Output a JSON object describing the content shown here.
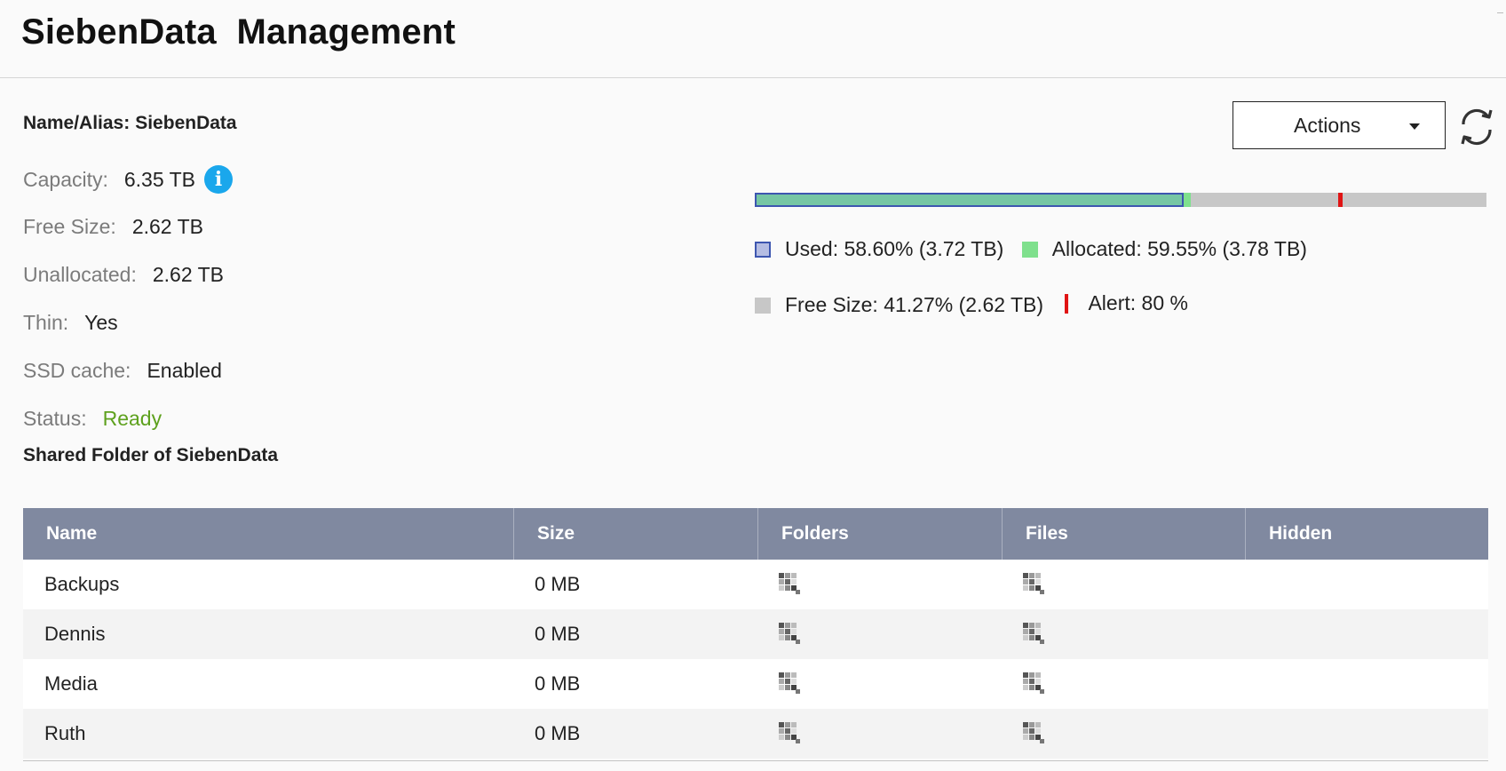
{
  "header": {
    "title": "SiebenData  Management"
  },
  "alias": {
    "label": "Name/Alias:",
    "value": "SiebenData"
  },
  "properties": {
    "capacity": {
      "label": "Capacity:",
      "value": "6.35 TB"
    },
    "free_size": {
      "label": "Free Size:",
      "value": "2.62 TB"
    },
    "unallocated": {
      "label": "Unallocated:",
      "value": "2.62 TB"
    },
    "thin": {
      "label": "Thin:",
      "value": "Yes"
    },
    "ssd_cache": {
      "label": "SSD cache:",
      "value": "Enabled"
    },
    "status": {
      "label": "Status:",
      "value": "Ready"
    }
  },
  "actions": {
    "label": "Actions"
  },
  "icons": {
    "info": "info-icon",
    "refresh": "refresh-icon",
    "dropdown": "caret-down-icon",
    "loading": "loading-placeholder-icon"
  },
  "usage": {
    "used_percent": 58.6,
    "allocated_percent": 59.55,
    "alert_percent": 80,
    "legend": {
      "used": "Used: 58.60% (3.72 TB)",
      "allocated": "Allocated: 59.55% (3.78 TB)",
      "free": "Free Size: 41.27% (2.62 TB)",
      "alert": "Alert: 80 %"
    }
  },
  "colors": {
    "ready": "#5ea11e",
    "used": "#3d56b0",
    "allocated": "#7fe08d",
    "free": "#c7c7c7",
    "alert": "#e01414",
    "table_header": "#8089a0",
    "info": "#1aa7ec"
  },
  "shared_folder": {
    "heading": "Shared Folder of SiebenData",
    "columns": [
      "Name",
      "Size",
      "Folders",
      "Files",
      "Hidden"
    ],
    "rows": [
      {
        "name": "Backups",
        "size": "0 MB"
      },
      {
        "name": "Dennis",
        "size": "0 MB"
      },
      {
        "name": "Media",
        "size": "0 MB"
      },
      {
        "name": "Ruth",
        "size": "0 MB"
      }
    ]
  }
}
